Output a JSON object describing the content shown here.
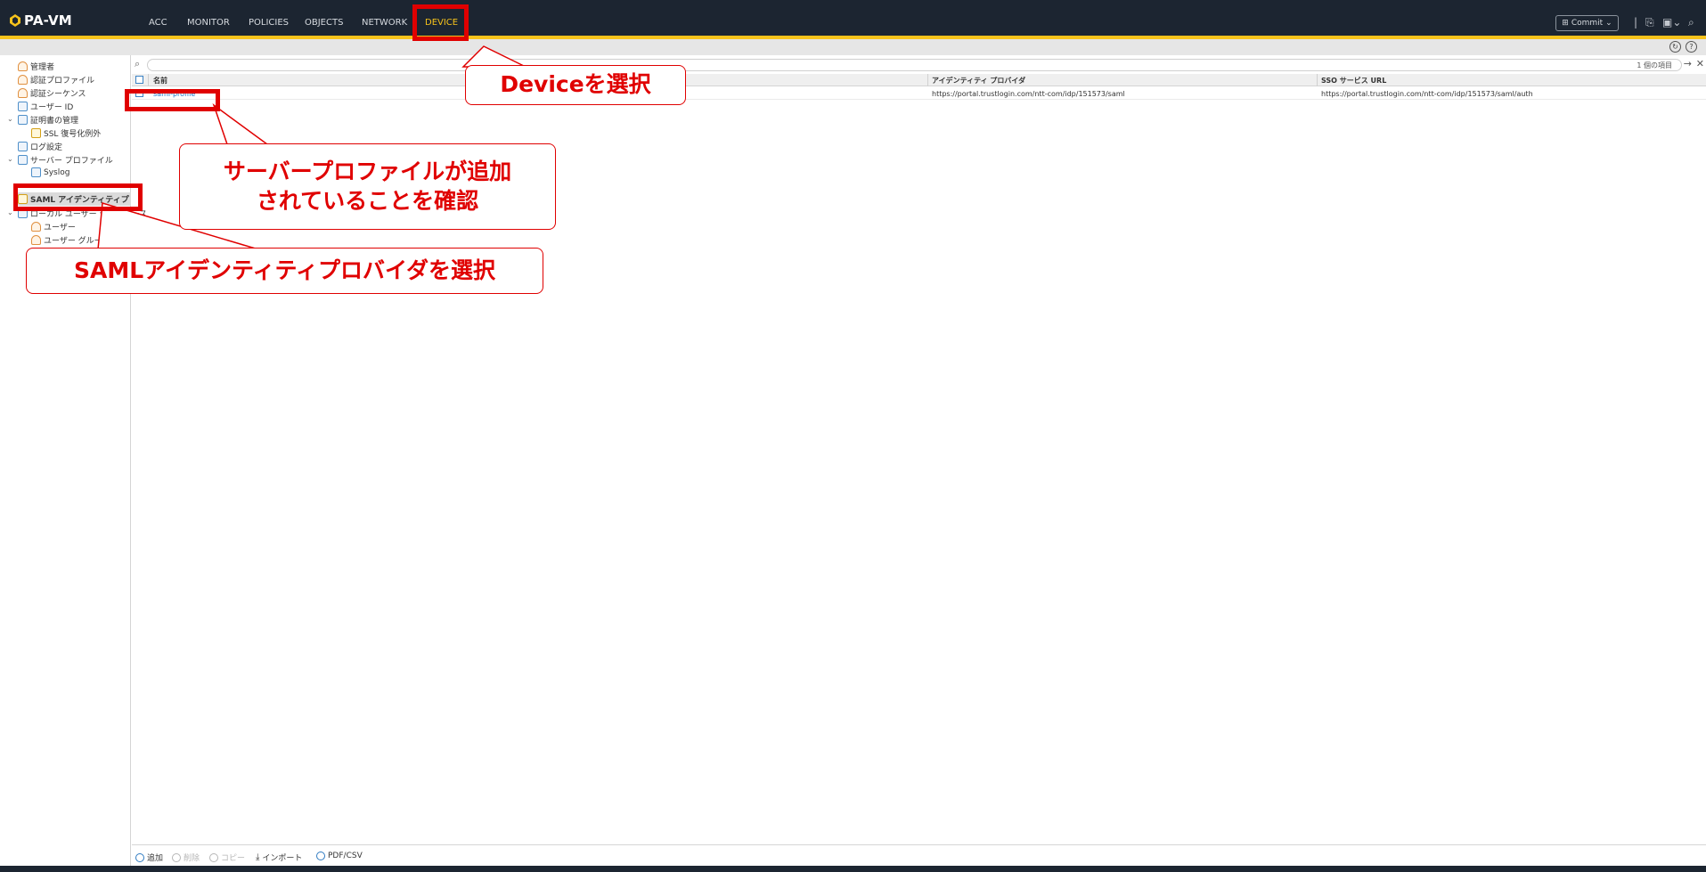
{
  "app": {
    "title": "PA-VM"
  },
  "nav": {
    "tabs": [
      {
        "label": "ACC"
      },
      {
        "label": "MONITOR"
      },
      {
        "label": "POLICIES"
      },
      {
        "label": "OBJECTS"
      },
      {
        "label": "NETWORK"
      },
      {
        "label": "DEVICE",
        "active": true
      }
    ],
    "commit_label": "Commit"
  },
  "sidebar": {
    "items": [
      {
        "label": "管理者",
        "icon": "user-icon"
      },
      {
        "label": "認証プロファイル",
        "icon": "auth-profile-icon"
      },
      {
        "label": "認証シーケンス",
        "icon": "auth-sequence-icon"
      },
      {
        "label": "ユーザー ID",
        "icon": "user-id-icon"
      },
      {
        "label": "証明書の管理",
        "icon": "certificate-icon"
      },
      {
        "label": "SSL 復号化例外",
        "icon": "lock-icon"
      },
      {
        "label": "ログ設定",
        "icon": "log-icon"
      },
      {
        "label": "サーバー プロファイル",
        "icon": "server-profile-icon"
      },
      {
        "label": "Syslog",
        "icon": "syslog-icon"
      },
      {
        "label": "SAML アイデンティティプ",
        "icon": "saml-icon",
        "selected": true
      },
      {
        "label": "ローカル ユーザー データベース",
        "icon": "database-icon"
      },
      {
        "label": "ユーザー",
        "icon": "user-icon"
      },
      {
        "label": "ユーザー グループ",
        "icon": "user-group-icon"
      }
    ]
  },
  "main": {
    "count_label": "1 個の項目",
    "columns": [
      "名前",
      "アイデンティティ プロバイダ",
      "SSO サービス URL"
    ],
    "rows": [
      {
        "name": "saml-profile",
        "idp": "https://portal.trustlogin.com/ntt-com/idp/151573/saml",
        "sso_url": "https://portal.trustlogin.com/ntt-com/idp/151573/saml/auth"
      }
    ],
    "footer_buttons": [
      {
        "label": "追加",
        "enabled": true
      },
      {
        "label": "削除",
        "enabled": false
      },
      {
        "label": "コピー",
        "enabled": false
      },
      {
        "label": "インポート",
        "enabled": true
      },
      {
        "label": "PDF/CSV",
        "enabled": true
      }
    ]
  },
  "annotations": {
    "device": "Deviceを選択",
    "confirm_line1": "サーバープロファイルが追加",
    "confirm_line2": "されていることを確認",
    "saml": "SAMLアイデンティティプロバイダを選択"
  },
  "colors": {
    "nav_bg": "#1c2531",
    "accent": "#f7c31b",
    "annotation": "#e00000",
    "link": "#1a73c8"
  }
}
